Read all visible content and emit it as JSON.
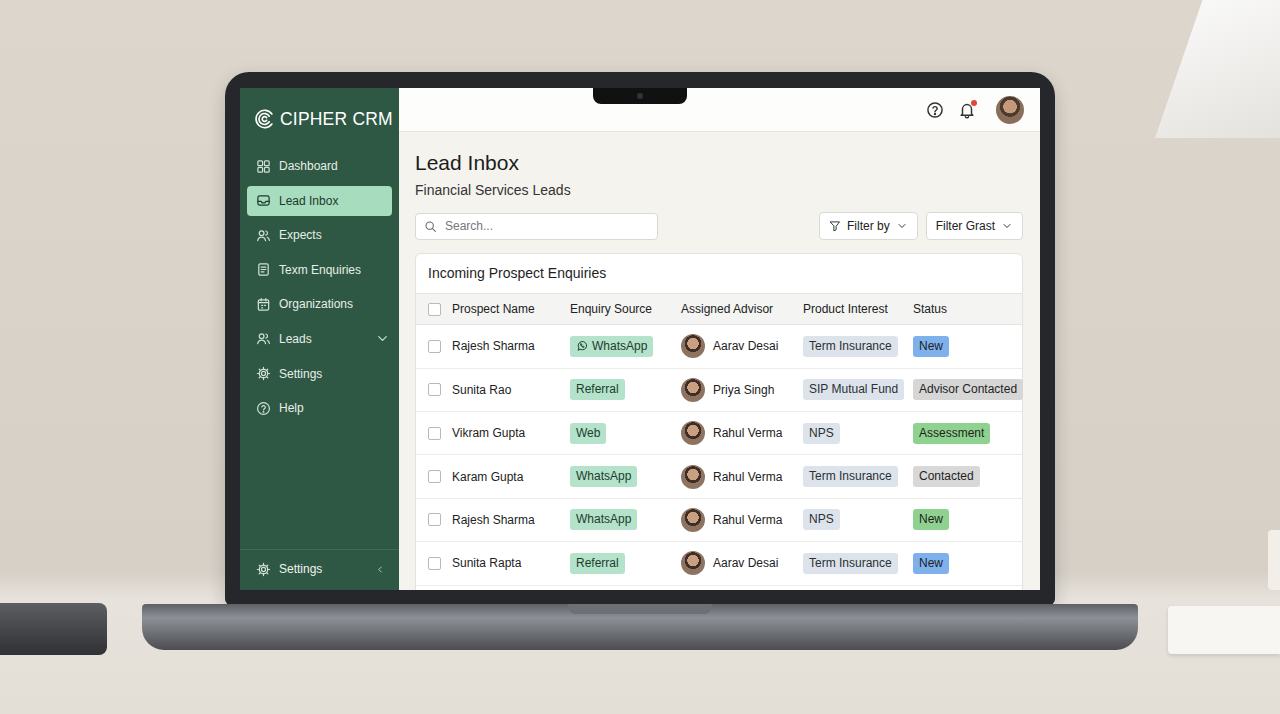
{
  "logo": "CIPHER CRM",
  "sidebar": {
    "items": [
      {
        "label": "Dashboard",
        "selected": false,
        "has_submenu": false
      },
      {
        "label": "Lead Inbox",
        "selected": true,
        "has_submenu": false
      },
      {
        "label": "Expects",
        "selected": false,
        "has_submenu": false
      },
      {
        "label": "Texm Enquiries",
        "selected": false,
        "has_submenu": false
      },
      {
        "label": "Organizations",
        "selected": false,
        "has_submenu": false
      },
      {
        "label": "Leads",
        "selected": false,
        "has_submenu": true
      },
      {
        "label": "Settings",
        "selected": false,
        "has_submenu": false
      },
      {
        "label": "Help",
        "selected": false,
        "has_submenu": false
      }
    ],
    "footer": {
      "label": "Settings"
    }
  },
  "topbar": {
    "notifications_unread": true
  },
  "page": {
    "title": "Lead Inbox",
    "subtitle": "Financial Services Leads"
  },
  "search": {
    "placeholder": "Search..."
  },
  "filters": [
    {
      "label": "Filter by",
      "kind": "funnel"
    },
    {
      "label": "Filter Grast",
      "kind": "plain"
    }
  ],
  "table": {
    "title": "Incoming Prospect Enquiries",
    "select_all": false,
    "columns": [
      "Prospect Name",
      "Enquiry Source",
      "Assigned Advisor",
      "Product Interest",
      "Status"
    ],
    "rows": [
      {
        "checked": false,
        "name": "Rajesh Sharma",
        "source": "WhatsApp",
        "source_kind": "whatsapp",
        "advisor": "Aarav Desai",
        "product": "Term Insurance",
        "status": "New",
        "status_color": "#7eb0ec"
      },
      {
        "checked": false,
        "name": "Sunita Rao",
        "source": "Referral",
        "source_kind": "plain",
        "advisor": "Priya Singh",
        "product": "SIP Mutual Fund",
        "status": "Advisor Contacted",
        "status_color": "#d6d6d6"
      },
      {
        "checked": false,
        "name": "Vikram Gupta",
        "source": "Web",
        "source_kind": "plain",
        "advisor": "Rahul Verma",
        "product": "NPS",
        "status": "Assessment",
        "status_color": "#8fd28f"
      },
      {
        "checked": false,
        "name": "Karam Gupta",
        "source": "WhatsApp",
        "source_kind": "plain",
        "advisor": "Rahul Verma",
        "product": "Term Insurance",
        "status": "Contacted",
        "status_color": "#d8d8d8"
      },
      {
        "checked": false,
        "name": "Rajesh Sharma",
        "source": "WhatsApp",
        "source_kind": "plain",
        "advisor": "Rahul Verma",
        "product": "NPS",
        "status": "New",
        "status_color": "#8fd28f"
      },
      {
        "checked": false,
        "name": "Sunita Rapta",
        "source": "Referral",
        "source_kind": "plain",
        "advisor": "Aarav Desai",
        "product": "Term Insurance",
        "status": "New",
        "status_color": "#7eb0ec"
      }
    ]
  }
}
